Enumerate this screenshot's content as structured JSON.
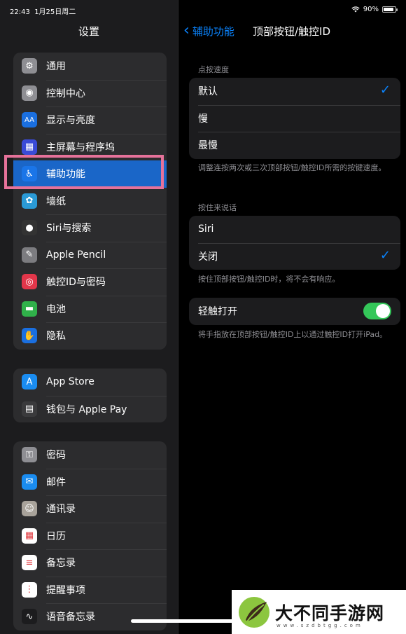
{
  "status_bar": {
    "time": "22:43",
    "date": "1月25日周二",
    "battery": "90%"
  },
  "left": {
    "title": "设置",
    "group1": [
      {
        "label": "通用",
        "icon": "gear-icon",
        "color": "#8e8e93",
        "glyph": "⚙"
      },
      {
        "label": "控制中心",
        "icon": "switches-icon",
        "color": "#8e8e93",
        "glyph": "◉"
      },
      {
        "label": "显示与亮度",
        "icon": "text-size-icon",
        "color": "#1a6fe0",
        "glyph": "AA"
      },
      {
        "label": "主屏幕与程序坞",
        "icon": "home-grid-icon",
        "color": "#3a4bd6",
        "glyph": "▦"
      },
      {
        "label": "辅助功能",
        "icon": "accessibility-icon",
        "color": "#1a75e8",
        "glyph": "♿"
      },
      {
        "label": "墙纸",
        "icon": "flower-icon",
        "color": "#2a9ad6",
        "glyph": "✿"
      },
      {
        "label": "Siri与搜索",
        "icon": "siri-icon",
        "color": "#333",
        "glyph": "●"
      },
      {
        "label": "Apple Pencil",
        "icon": "pencil-icon",
        "color": "#7c7c80",
        "glyph": "✎"
      },
      {
        "label": "触控ID与密码",
        "icon": "fingerprint-icon",
        "color": "#e2364a",
        "glyph": "◎"
      },
      {
        "label": "电池",
        "icon": "battery-icon",
        "color": "#30b14a",
        "glyph": "▬"
      },
      {
        "label": "隐私",
        "icon": "hand-icon",
        "color": "#1a6fe0",
        "glyph": "✋"
      }
    ],
    "group2": [
      {
        "label": "App Store",
        "icon": "app-store-icon",
        "color": "#1a8cf0",
        "glyph": "A"
      },
      {
        "label": "钱包与 Apple Pay",
        "icon": "wallet-icon",
        "color": "#3a3a3c",
        "glyph": "▤"
      }
    ],
    "group3": [
      {
        "label": "密码",
        "icon": "key-icon",
        "color": "#8e8e93",
        "glyph": "⚿"
      },
      {
        "label": "邮件",
        "icon": "mail-icon",
        "color": "#1a8cf0",
        "glyph": "✉"
      },
      {
        "label": "通讯录",
        "icon": "contacts-icon",
        "color": "#a8a29a",
        "glyph": "☺"
      },
      {
        "label": "日历",
        "icon": "calendar-icon",
        "color": "#ffffff",
        "glyph": "▦"
      },
      {
        "label": "备忘录",
        "icon": "notes-icon",
        "color": "#ffffff",
        "glyph": "≡"
      },
      {
        "label": "提醒事项",
        "icon": "reminders-icon",
        "color": "#ffffff",
        "glyph": "⋮"
      },
      {
        "label": "语音备忘录",
        "icon": "voice-memo-icon",
        "color": "#1c1c1e",
        "glyph": "∿"
      }
    ]
  },
  "right": {
    "back_label": "辅助功能",
    "title": "顶部按钮/触控ID",
    "click_speed": {
      "header": "点按速度",
      "options": [
        "默认",
        "慢",
        "最慢"
      ],
      "footnote": "调整连按两次或三次顶部按钮/触控ID所需的按键速度。"
    },
    "press_to_speak": {
      "header": "按住来说话",
      "options": [
        "Siri",
        "关闭"
      ],
      "footnote": "按住顶部按钮/触控ID时，将不会有响应。"
    },
    "rest_to_open": {
      "label": "轻触打开",
      "footnote": "将手指放在顶部按钮/触控ID上以通过触控ID打开iPad。"
    }
  },
  "watermark": {
    "text": "大不同手游网",
    "url": "www.szdbtgg.com"
  }
}
